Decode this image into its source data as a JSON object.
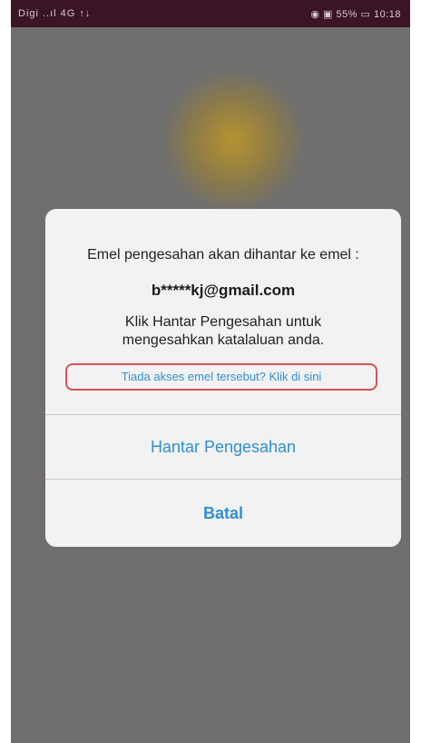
{
  "status_bar": {
    "left_text": "Digi ..ıl 4G ↑↓",
    "right_text": "◉ ▣ 55% ▭ 10:18"
  },
  "dialog": {
    "message": "Emel pengesahan akan dihantar ke emel :",
    "email": "b*****kj@gmail.com",
    "instruction": "Klik Hantar Pengesahan untuk mengesahkan katalaluan anda.",
    "help_link": "Tiada akses emel tersebut? Klik di sini",
    "send_button": "Hantar Pengesahan",
    "cancel_button": "Batal"
  },
  "colors": {
    "accent": "#2f8fd8",
    "highlight_border": "#d9534f",
    "status_bar": "#3b1426",
    "overlay": "#6f6f6f"
  }
}
